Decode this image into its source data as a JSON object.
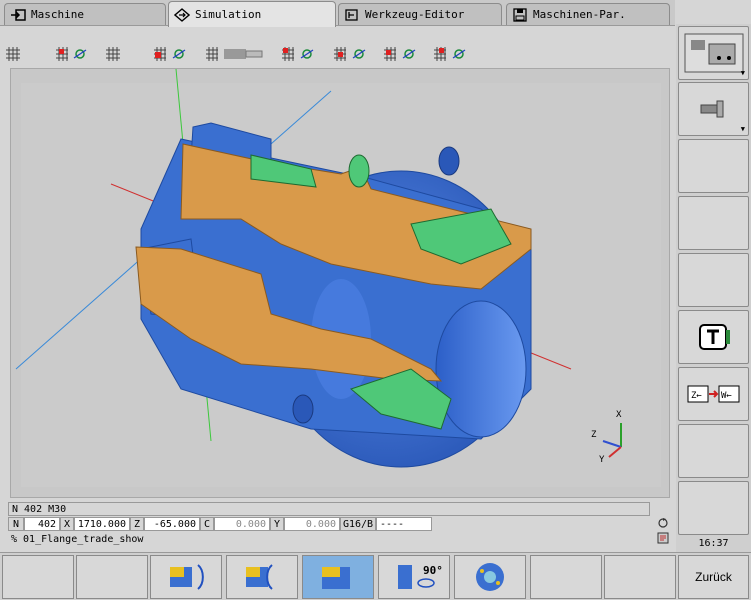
{
  "tabs": [
    {
      "label": "Maschine",
      "icon": "arrow-into-box-icon"
    },
    {
      "label": "Simulation",
      "icon": "diamond-arrow-icon"
    },
    {
      "label": "Werkzeug-Editor",
      "icon": "tool-editor-icon"
    },
    {
      "label": "Maschinen-Par.",
      "icon": "floppy-disk-icon"
    }
  ],
  "status": {
    "nc_line": "N 402 M30",
    "n_label": "N",
    "n_value": "402",
    "x_label": "X",
    "x_value": "1710.000",
    "z_label": "Z",
    "z_value": "-65.000",
    "c_label": "C",
    "c_value": "0.000",
    "y_label": "Y",
    "y_value": "0.000",
    "g_label": "G16/B",
    "g_value": "----",
    "program": "% 01_Flange_trade_show"
  },
  "axes_triad": {
    "x": "X",
    "y": "Y",
    "z": "Z"
  },
  "clock": "16:37",
  "bottom": {
    "back_label": "Zurück",
    "rotate_label": "90°"
  },
  "colors": {
    "part_blue": "#3a6fd0",
    "cut_orange": "#d99a4a",
    "tool_green": "#4fc878",
    "active_key": "#7fb0e0"
  }
}
